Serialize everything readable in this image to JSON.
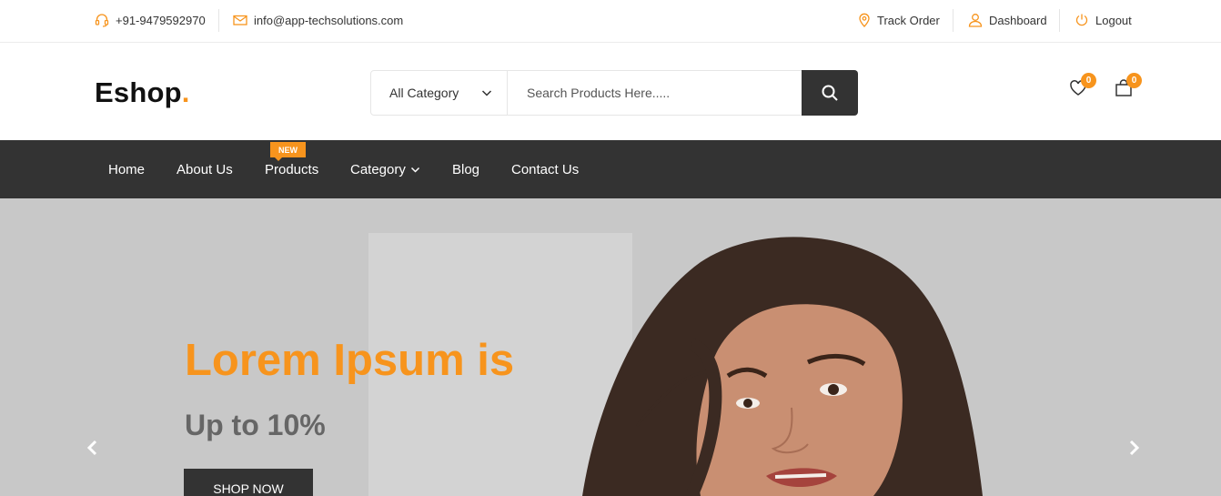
{
  "topbar": {
    "phone": "+91-9479592970",
    "email": "info@app-techsolutions.com",
    "track_order": "Track Order",
    "dashboard": "Dashboard",
    "logout": "Logout"
  },
  "header": {
    "logo_text": "Eshop",
    "logo_dot": ".",
    "category_selected": "All Category",
    "search_placeholder": "Search Products Here.....",
    "wishlist_count": "0",
    "cart_count": "0"
  },
  "nav": {
    "items": [
      "Home",
      "About Us",
      "Products",
      "Category",
      "Blog",
      "Contact Us"
    ],
    "new_badge": "NEW"
  },
  "hero": {
    "title": "Lorem Ipsum is",
    "subtitle": "Up to 10%",
    "cta": "SHOP NOW"
  },
  "colors": {
    "accent": "#f7941d",
    "dark": "#333333",
    "hero_bg": "#c8c8c8"
  }
}
